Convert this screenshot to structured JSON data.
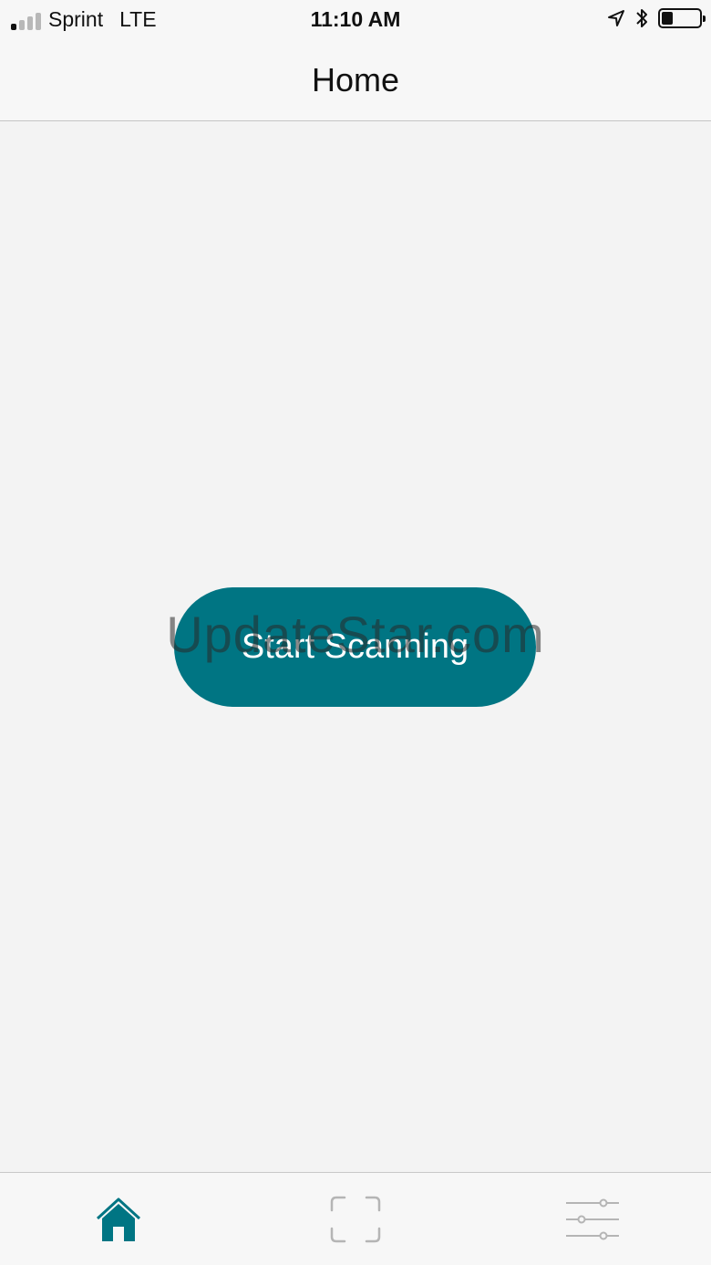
{
  "status_bar": {
    "carrier": "Sprint",
    "network": "LTE",
    "time": "11:10 AM",
    "icons": [
      "signal-icon",
      "location-arrow-icon",
      "bluetooth-icon",
      "battery-icon"
    ]
  },
  "nav": {
    "title": "Home"
  },
  "main": {
    "scan_button_label": "Start Scanning",
    "watermark": "UpdateStar.com"
  },
  "tabs": [
    {
      "icon": "home-icon",
      "active": true
    },
    {
      "icon": "scan-frame-icon",
      "active": false
    },
    {
      "icon": "sliders-icon",
      "active": false
    }
  ],
  "colors": {
    "accent": "#007583",
    "inactive_tab": "#b5b5b5",
    "background": "#f3f3f3"
  }
}
